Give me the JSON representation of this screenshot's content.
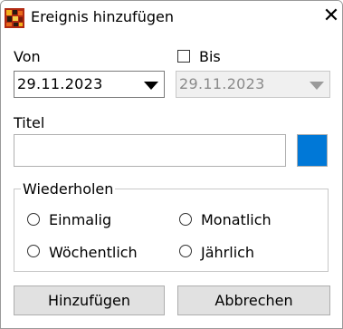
{
  "window": {
    "title": "Ereignis hinzufügen",
    "close_glyph": "✕"
  },
  "from": {
    "label": "Von",
    "value": "29.11.2023"
  },
  "to": {
    "label": "Bis",
    "value": "29.11.2023",
    "checked": false,
    "enabled": false
  },
  "title_field": {
    "label": "Titel",
    "value": "",
    "color": "#0078d7"
  },
  "repeat": {
    "legend": "Wiederholen",
    "options": [
      "Einmalig",
      "Monatlich",
      "Wöchentlich",
      "Jährlich"
    ]
  },
  "buttons": {
    "add": "Hinzufügen",
    "cancel": "Abbrechen"
  }
}
